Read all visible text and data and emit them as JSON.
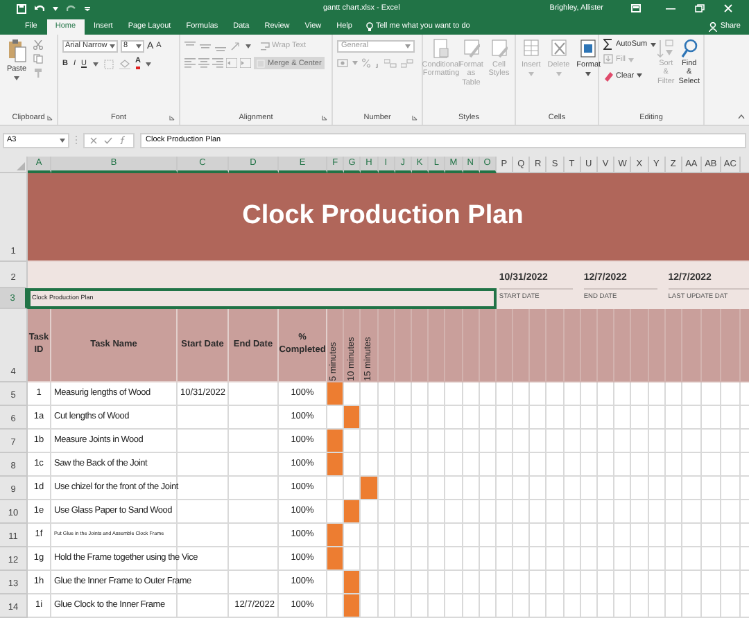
{
  "window": {
    "title": "gantt chart.xlsx - Excel",
    "user": "Brighley, Allister"
  },
  "tabs": [
    {
      "label": "File",
      "selected": false
    },
    {
      "label": "Home",
      "selected": true
    },
    {
      "label": "Insert",
      "selected": false
    },
    {
      "label": "Page Layout",
      "selected": false
    },
    {
      "label": "Formulas",
      "selected": false
    },
    {
      "label": "Data",
      "selected": false
    },
    {
      "label": "Review",
      "selected": false
    },
    {
      "label": "View",
      "selected": false
    },
    {
      "label": "Help",
      "selected": false
    }
  ],
  "tell_me": "Tell me what you want to do",
  "share": "Share",
  "ribbon": {
    "clipboard": {
      "label": "Clipboard",
      "paste": "Paste"
    },
    "font": {
      "label": "Font",
      "name": "Arial Narrow",
      "size": "8",
      "grow": "A",
      "shrink": "A",
      "bold": "B",
      "italic": "I",
      "underline": "U",
      "color_button": "A"
    },
    "alignment": {
      "label": "Alignment",
      "wrap": {
        "label": "Wrap Text",
        "disabled": true
      },
      "merge": {
        "label": "Merge & Center",
        "disabled": true
      }
    },
    "number": {
      "label": "Number",
      "format": "General"
    },
    "styles": {
      "label": "Styles",
      "buttons": [
        {
          "label": "Conditional Formatting",
          "disabled": true
        },
        {
          "label": "Format as Table",
          "disabled": true
        },
        {
          "label": "Cell Styles",
          "disabled": true
        }
      ]
    },
    "cells": {
      "label": "Cells",
      "buttons": [
        {
          "label": "Insert",
          "disabled": true
        },
        {
          "label": "Delete",
          "disabled": true
        },
        {
          "label": "Format",
          "disabled": false
        }
      ]
    },
    "editing": {
      "label": "Editing",
      "small": [
        {
          "label": "AutoSum",
          "disabled": false
        },
        {
          "label": "Fill",
          "disabled": true
        },
        {
          "label": "Clear",
          "disabled": false
        }
      ],
      "big": [
        {
          "label": "Sort & Filter",
          "disabled": true
        },
        {
          "label": "Find & Select",
          "disabled": false
        }
      ]
    }
  },
  "name_box": "A3",
  "formula": "Clock Production Plan",
  "columns": [
    {
      "label": "A",
      "selected": true
    },
    {
      "label": "B",
      "selected": true
    },
    {
      "label": "C",
      "selected": true
    },
    {
      "label": "D",
      "selected": true
    },
    {
      "label": "E",
      "selected": true
    },
    {
      "label": "F",
      "selected": true
    },
    {
      "label": "G",
      "selected": true
    },
    {
      "label": "H",
      "selected": true
    },
    {
      "label": "I",
      "selected": true
    },
    {
      "label": "J",
      "selected": true
    },
    {
      "label": "K",
      "selected": true
    },
    {
      "label": "L",
      "selected": true
    },
    {
      "label": "M",
      "selected": true
    },
    {
      "label": "N",
      "selected": true
    },
    {
      "label": "O",
      "selected": true
    },
    {
      "label": "P",
      "selected": false
    },
    {
      "label": "Q",
      "selected": false
    },
    {
      "label": "R",
      "selected": false
    },
    {
      "label": "S",
      "selected": false
    },
    {
      "label": "T",
      "selected": false
    },
    {
      "label": "U",
      "selected": false
    },
    {
      "label": "V",
      "selected": false
    },
    {
      "label": "W",
      "selected": false
    },
    {
      "label": "X",
      "selected": false
    },
    {
      "label": "Y",
      "selected": false
    },
    {
      "label": "Z",
      "selected": false
    },
    {
      "label": "AA",
      "selected": false
    },
    {
      "label": "AB",
      "selected": false
    },
    {
      "label": "AC",
      "selected": false
    }
  ],
  "rows": [
    {
      "label": "1",
      "selected": false
    },
    {
      "label": "2",
      "selected": false
    },
    {
      "label": "3",
      "selected": true
    },
    {
      "label": "4",
      "selected": false
    },
    {
      "label": "5",
      "selected": false
    },
    {
      "label": "6",
      "selected": false
    },
    {
      "label": "7",
      "selected": false
    },
    {
      "label": "8",
      "selected": false
    },
    {
      "label": "9",
      "selected": false
    },
    {
      "label": "10",
      "selected": false
    },
    {
      "label": "11",
      "selected": false
    },
    {
      "label": "12",
      "selected": false
    },
    {
      "label": "13",
      "selected": false
    },
    {
      "label": "14",
      "selected": false
    }
  ],
  "sheet": {
    "title": "Clock Production Plan",
    "selected_cell": "Clock Production Plan",
    "dates": [
      {
        "value": "10/31/2022",
        "label": "START DATE"
      },
      {
        "value": "12/7/2022",
        "label": "END DATE"
      },
      {
        "value": "12/7/2022",
        "label": "LAST UPDATE DAT"
      }
    ],
    "headers": [
      "Task ID",
      "Task Name",
      "Start Date",
      "End Date",
      "% Completed"
    ],
    "timeline_headers": [
      "5 minutes",
      "10 minutes",
      "15 minutes"
    ],
    "tasks": [
      {
        "id": "1",
        "name": "Measurig lengths of Wood",
        "start": "10/31/2022",
        "done": "100%",
        "small_text": false,
        "timeline": [
          true,
          false,
          false
        ]
      },
      {
        "id": "1a",
        "name": "Cut lengths of Wood",
        "done": "100%",
        "small_text": false,
        "timeline": [
          false,
          true,
          false
        ]
      },
      {
        "id": "1b",
        "name": "Measure Joints in Wood",
        "done": "100%",
        "small_text": false,
        "timeline": [
          true,
          false,
          false
        ]
      },
      {
        "id": "1c",
        "name": "Saw the Back of the Joint",
        "done": "100%",
        "small_text": false,
        "timeline": [
          true,
          false,
          false
        ]
      },
      {
        "id": "1d",
        "name": "Use chizel for the front of the Joint",
        "done": "100%",
        "small_text": false,
        "timeline": [
          false,
          false,
          true
        ]
      },
      {
        "id": "1e",
        "name": "Use Glass Paper to Sand Wood",
        "done": "100%",
        "small_text": false,
        "timeline": [
          false,
          true,
          false
        ]
      },
      {
        "id": "1f",
        "name": "Put Glue in the Joints and Assemble Clock Frame",
        "done": "100%",
        "small_text": true,
        "timeline": [
          true,
          false,
          false
        ]
      },
      {
        "id": "1g",
        "name": "Hold the Frame together using the Vice",
        "done": "100%",
        "small_text": false,
        "timeline": [
          true,
          false,
          false
        ]
      },
      {
        "id": "1h",
        "name": "Glue the Inner Frame to Outer Frame",
        "done": "100%",
        "small_text": false,
        "timeline": [
          false,
          true,
          false
        ]
      },
      {
        "id": "1i",
        "name": "Glue Clock to the Inner Frame",
        "end": "12/7/2022",
        "done": "100%",
        "small_text": false,
        "timeline": [
          false,
          true,
          false
        ]
      }
    ]
  }
}
